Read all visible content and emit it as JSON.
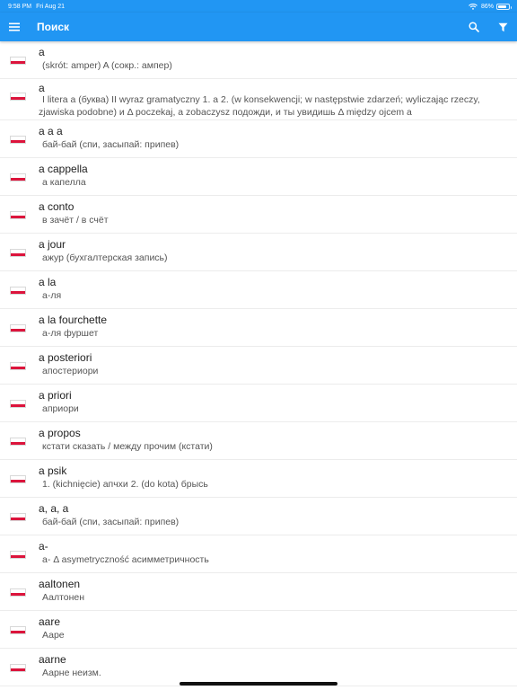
{
  "status_bar": {
    "time": "9:58 PM",
    "date": "Fri Aug 21",
    "battery_pct": "86%",
    "battery_level": 0.86
  },
  "app_bar": {
    "title": "Поиск",
    "menu_icon": "hamburger-menu-icon",
    "search_icon": "search-icon",
    "filter_icon": "filter-icon"
  },
  "colors": {
    "primary": "#2196f3",
    "flag_red": "#dc143c",
    "divider": "#ececec"
  },
  "entries": [
    {
      "headword": "a",
      "translation": "(skrót: amper) A (сокр.: ампер)"
    },
    {
      "headword": "a",
      "translation": "I litera a (буква) II wyraz gramatyczny 1. a 2. (w konsekwencji; w następstwie zdarzeń; wyliczając rzeczy, zjawiska podobne) и Δ poczekaj, a zobaczysz подожди, и ты увидишь Δ między ojcem a"
    },
    {
      "headword": "a a a",
      "translation": "бай-бай (спи, засыпай: припев)"
    },
    {
      "headword": "a cappella",
      "translation": "а капелла"
    },
    {
      "headword": "a conto",
      "translation": "в зачёт / в счёт"
    },
    {
      "headword": "a jour",
      "translation": "ажур (бухгалтерская запись)"
    },
    {
      "headword": "a la",
      "translation": "а-ля"
    },
    {
      "headword": "a la fourchette",
      "translation": "а-ля фуршет"
    },
    {
      "headword": "a posteriori",
      "translation": "апостериори"
    },
    {
      "headword": "a priori",
      "translation": "априори"
    },
    {
      "headword": "a propos",
      "translation": "кстати сказать / между прочим (кстати)"
    },
    {
      "headword": "a psik",
      "translation": "1. (kichnięcie) апчхи 2. (do kota) брысь"
    },
    {
      "headword": "a, a, a",
      "translation": "бай-бай (спи, засыпай: припев)"
    },
    {
      "headword": "a-",
      "translation": "a- Δ asymetryczność асимметричность"
    },
    {
      "headword": "aaltonen",
      "translation": "Аалтонен"
    },
    {
      "headword": "aare",
      "translation": "Ааре"
    },
    {
      "headword": "aarne",
      "translation": "Аарне неизм."
    }
  ]
}
